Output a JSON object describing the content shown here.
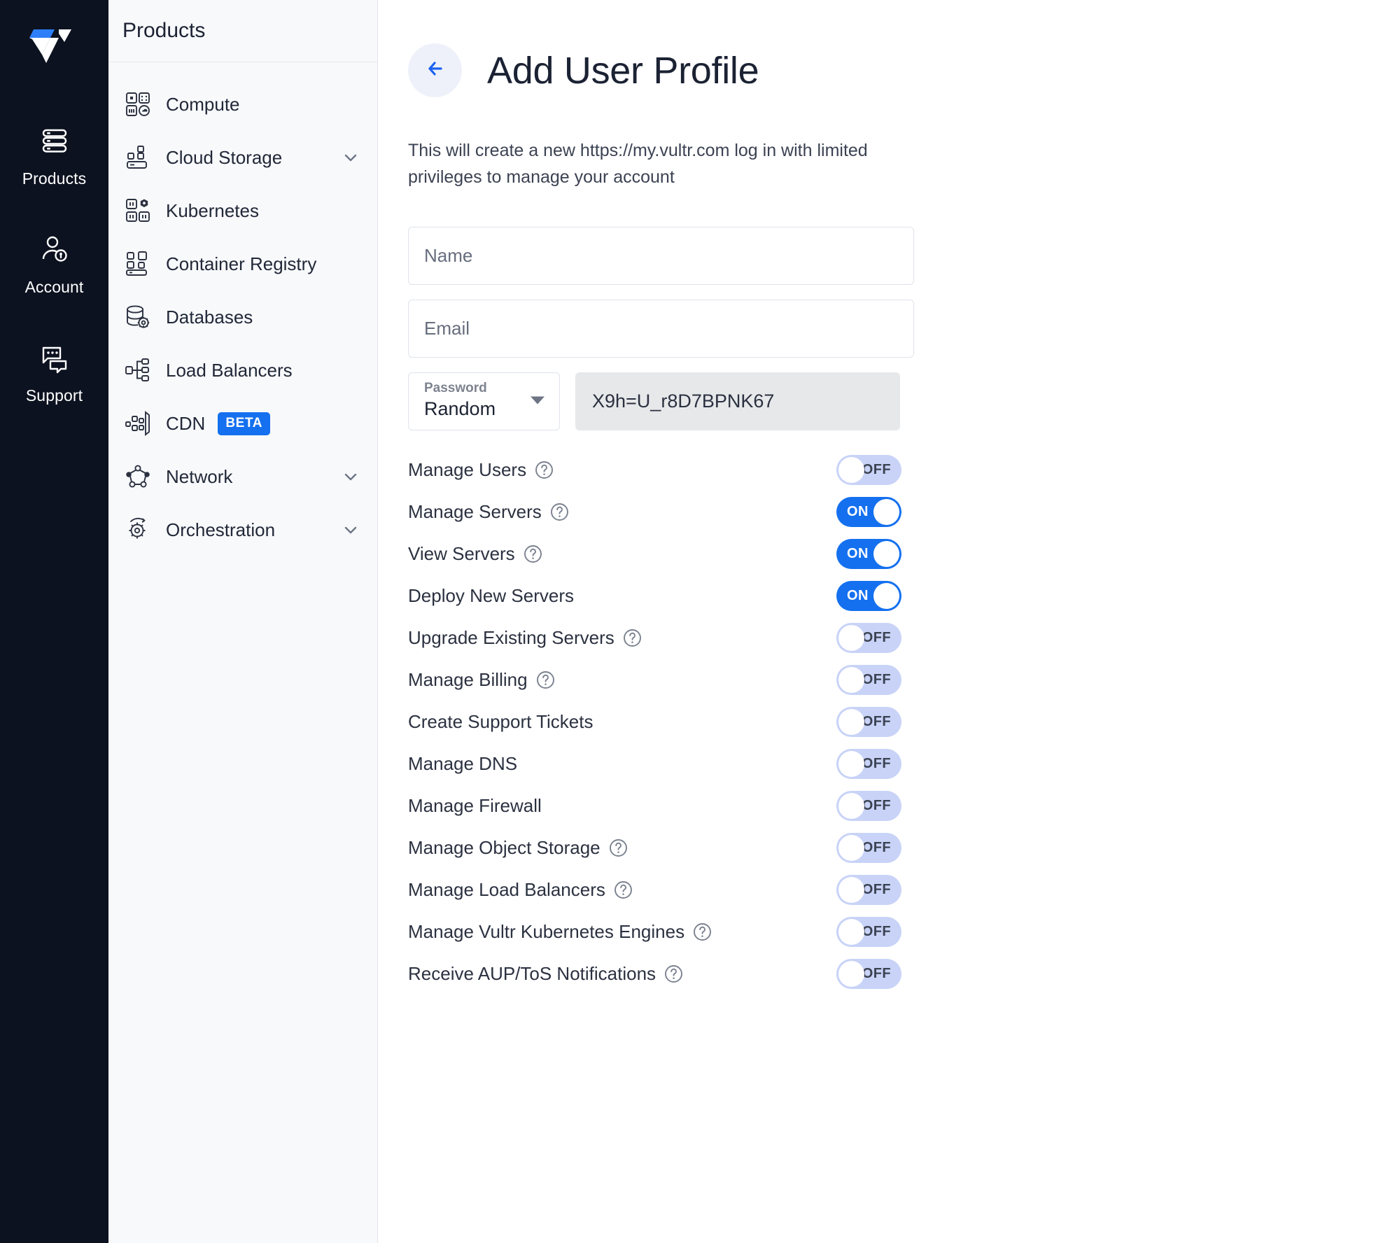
{
  "rail": {
    "logo_alt": "vultr-logo",
    "items": [
      {
        "label": "Products",
        "icon": "servers-icon"
      },
      {
        "label": "Account",
        "icon": "user-key-icon"
      },
      {
        "label": "Support",
        "icon": "chat-bubbles-icon"
      }
    ]
  },
  "products_panel": {
    "title": "Products",
    "items": [
      {
        "label": "Compute",
        "icon": "compute-icon",
        "chevron": false,
        "badge": null
      },
      {
        "label": "Cloud Storage",
        "icon": "cloud-storage-icon",
        "chevron": true,
        "badge": null
      },
      {
        "label": "Kubernetes",
        "icon": "kubernetes-icon",
        "chevron": false,
        "badge": null
      },
      {
        "label": "Container Registry",
        "icon": "container-registry-icon",
        "chevron": false,
        "badge": null
      },
      {
        "label": "Databases",
        "icon": "database-gear-icon",
        "chevron": false,
        "badge": null
      },
      {
        "label": "Load Balancers",
        "icon": "load-balancer-icon",
        "chevron": false,
        "badge": null
      },
      {
        "label": "CDN",
        "icon": "cdn-icon",
        "chevron": false,
        "badge": "BETA"
      },
      {
        "label": "Network",
        "icon": "network-icon",
        "chevron": true,
        "badge": null
      },
      {
        "label": "Orchestration",
        "icon": "orchestration-icon",
        "chevron": true,
        "badge": null
      }
    ]
  },
  "main": {
    "back_icon": "arrow-left-icon",
    "title": "Add User Profile",
    "intro": "This will create a new https://my.vultr.com log in with limited privileges to manage your account",
    "form": {
      "name_placeholder": "Name",
      "email_placeholder": "Email",
      "password_select_label": "Password",
      "password_select_value": "Random",
      "password_value": "X9h=U_r8D7BPNK67"
    },
    "permissions": [
      {
        "label": "Manage Users",
        "help": true,
        "state": "OFF"
      },
      {
        "label": "Manage Servers",
        "help": true,
        "state": "ON"
      },
      {
        "label": "View Servers",
        "help": true,
        "state": "ON"
      },
      {
        "label": "Deploy New Servers",
        "help": false,
        "state": "ON"
      },
      {
        "label": "Upgrade Existing Servers",
        "help": true,
        "state": "OFF"
      },
      {
        "label": "Manage Billing",
        "help": true,
        "state": "OFF"
      },
      {
        "label": "Create Support Tickets",
        "help": false,
        "state": "OFF"
      },
      {
        "label": "Manage DNS",
        "help": false,
        "state": "OFF"
      },
      {
        "label": "Manage Firewall",
        "help": false,
        "state": "OFF"
      },
      {
        "label": "Manage Object Storage",
        "help": true,
        "state": "OFF"
      },
      {
        "label": "Manage Load Balancers",
        "help": true,
        "state": "OFF"
      },
      {
        "label": "Manage Vultr Kubernetes Engines",
        "help": true,
        "state": "OFF"
      },
      {
        "label": "Receive AUP/ToS Notifications",
        "help": true,
        "state": "OFF"
      }
    ]
  },
  "colors": {
    "accent_blue": "#1470ef",
    "rail_bg": "#0d1220",
    "panel_bg": "#f8f9fb",
    "toggle_off_track": "#c8d3f7",
    "password_field_bg": "#e7e8ea"
  }
}
